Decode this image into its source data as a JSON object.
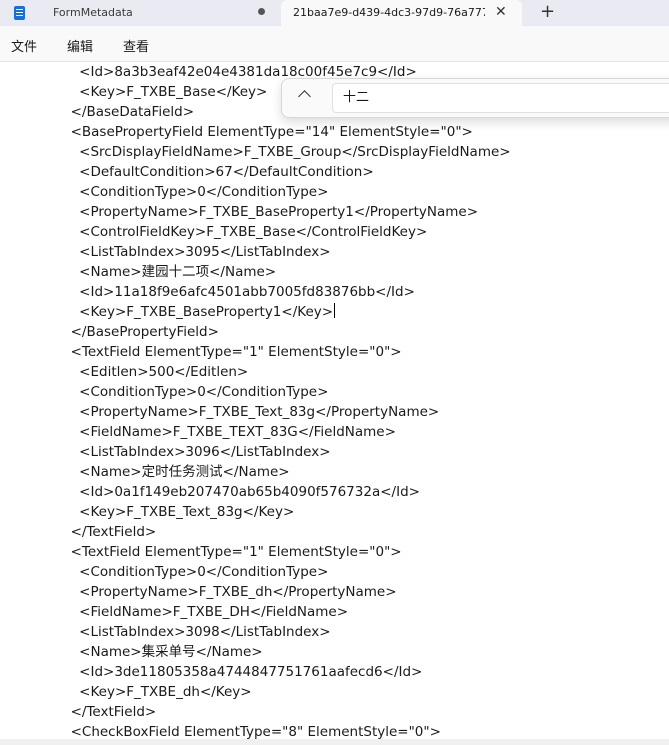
{
  "tabs": [
    {
      "title": "FormMetadata",
      "icon": "notepad-icon",
      "modified": true
    },
    {
      "title": "21baa7e9-d439-4dc3-97d9-76a777",
      "active": true
    }
  ],
  "menu": [
    "文件",
    "编辑",
    "查看"
  ],
  "find": {
    "query": "十二"
  },
  "editor": {
    "lines": [
      "    <Id>8a3b3eaf42e04e4381da18c00f45e7c9</Id>",
      "    <Key>F_TXBE_Base</Key>",
      "  </BaseDataField>",
      "  <BasePropertyField ElementType=\"14\" ElementStyle=\"0\">",
      "    <SrcDisplayFieldName>F_TXBE_Group</SrcDisplayFieldName>",
      "    <DefaultCondition>67</DefaultCondition>",
      "    <ConditionType>0</ConditionType>",
      "    <PropertyName>F_TXBE_BaseProperty1</PropertyName>",
      "    <ControlFieldKey>F_TXBE_Base</ControlFieldKey>",
      "    <ListTabIndex>3095</ListTabIndex>",
      "    <Name>建园十二项</Name>",
      "    <Id>11a18f9e6afc4501abb7005fd83876bb</Id>",
      "    <Key>F_TXBE_BaseProperty1</Key>",
      "  </BasePropertyField>",
      "  <TextField ElementType=\"1\" ElementStyle=\"0\">",
      "    <Editlen>500</Editlen>",
      "    <ConditionType>0</ConditionType>",
      "    <PropertyName>F_TXBE_Text_83g</PropertyName>",
      "    <FieldName>F_TXBE_TEXT_83G</FieldName>",
      "    <ListTabIndex>3096</ListTabIndex>",
      "    <Name>定时任务测试</Name>",
      "    <Id>0a1f149eb207470ab65b4090f576732a</Id>",
      "    <Key>F_TXBE_Text_83g</Key>",
      "  </TextField>",
      "  <TextField ElementType=\"1\" ElementStyle=\"0\">",
      "    <ConditionType>0</ConditionType>",
      "    <PropertyName>F_TXBE_dh</PropertyName>",
      "    <FieldName>F_TXBE_DH</FieldName>",
      "    <ListTabIndex>3098</ListTabIndex>",
      "    <Name>集采单号</Name>",
      "    <Id>3de11805358a4744847751761aafecd6</Id>",
      "    <Key>F_TXBE_dh</Key>",
      "  </TextField>",
      "  <CheckBoxField ElementType=\"8\" ElementStyle=\"0\">"
    ]
  }
}
